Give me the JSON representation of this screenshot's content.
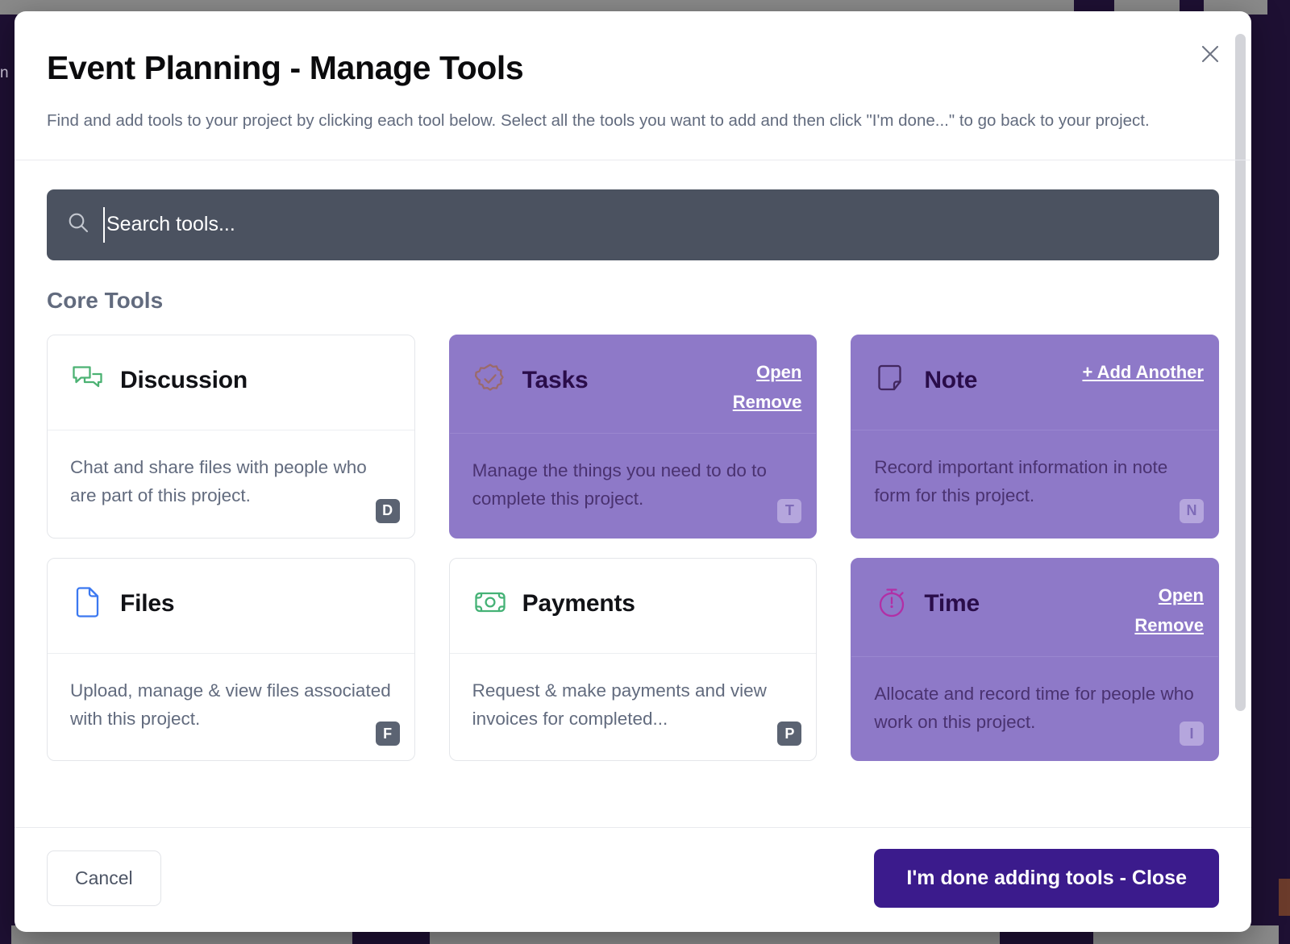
{
  "modal": {
    "title": "Event Planning - Manage Tools",
    "subtitle": "Find and add tools to your project by clicking each tool below. Select all the tools you want to add and then click \"I'm done...\" to go back to your project.",
    "close_icon": "close-icon"
  },
  "search": {
    "placeholder": "Search tools...",
    "value": "",
    "icon": "search-icon"
  },
  "sections": [
    {
      "title": "Core Tools"
    }
  ],
  "tools": [
    {
      "name": "Discussion",
      "description": "Chat and share files with people who are part of this project.",
      "shortcut": "D",
      "icon": "chat-bubbles-icon",
      "icon_color": "#4cb273",
      "selected": false,
      "actions": []
    },
    {
      "name": "Tasks",
      "description": "Manage the things you need to do to complete this project.",
      "shortcut": "T",
      "icon": "check-badge-icon",
      "icon_color": "#9b6a6a",
      "selected": true,
      "actions": [
        "Open",
        "Remove"
      ]
    },
    {
      "name": "Note",
      "description": "Record important information in note form for this project.",
      "shortcut": "N",
      "icon": "note-page-icon",
      "icon_color": "#42275f",
      "selected": true,
      "actions": [
        "+ Add Another"
      ]
    },
    {
      "name": "Files",
      "description": "Upload, manage & view files associated with this project.",
      "shortcut": "F",
      "icon": "file-document-icon",
      "icon_color": "#3b78f0",
      "selected": false,
      "actions": []
    },
    {
      "name": "Payments",
      "description": "Request & make payments and view invoices for completed...",
      "shortcut": "P",
      "icon": "banknote-icon",
      "icon_color": "#45b276",
      "selected": false,
      "actions": []
    },
    {
      "name": "Time",
      "description": "Allocate and record time for people who work on this project.",
      "shortcut": "I",
      "icon": "stopwatch-icon",
      "icon_color": "#b22fa6",
      "selected": true,
      "actions": [
        "Open",
        "Remove"
      ]
    }
  ],
  "footer": {
    "cancel_label": "Cancel",
    "done_label": "I'm done adding tools - Close"
  },
  "background": {
    "sidebar_fragment": "n",
    "colors": {
      "accent_purple": "#3b1b8c",
      "selected_card": "#8e79c8",
      "search_bar": "#4b5260"
    }
  }
}
